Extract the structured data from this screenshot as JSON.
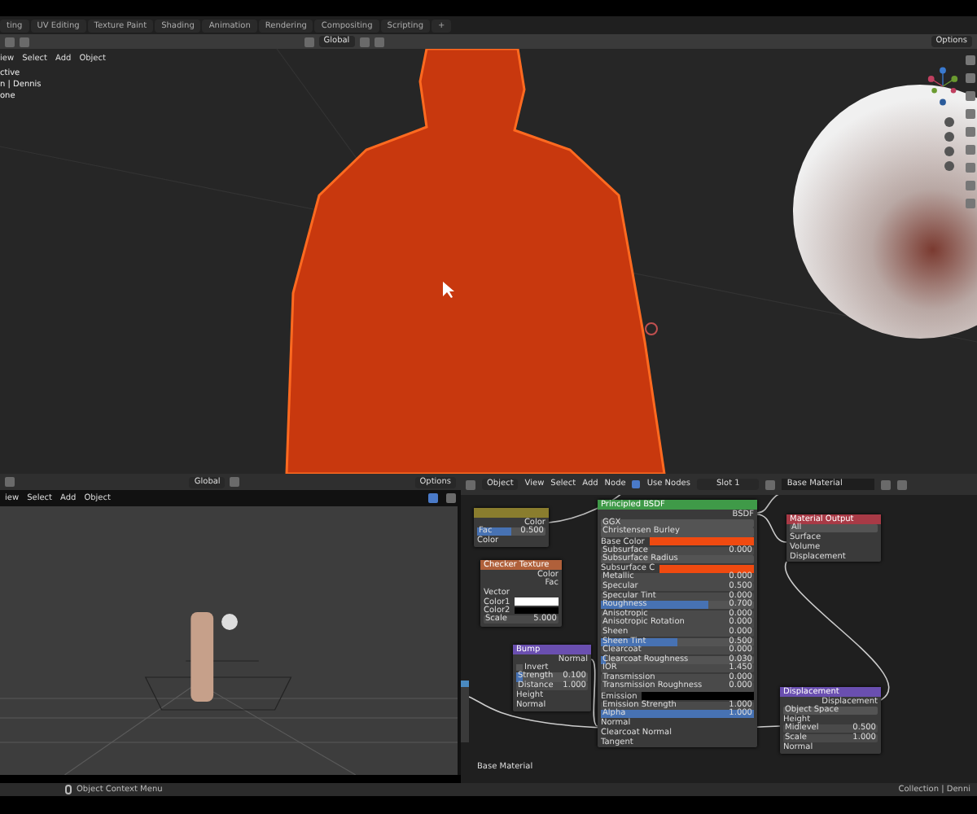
{
  "workspace_tabs": [
    {
      "label": "ting"
    },
    {
      "label": "UV Editing"
    },
    {
      "label": "Texture Paint"
    },
    {
      "label": "Shading"
    },
    {
      "label": "Animation"
    },
    {
      "label": "Rendering"
    },
    {
      "label": "Compositing"
    },
    {
      "label": "Scripting"
    },
    {
      "label": "+"
    }
  ],
  "top_viewport": {
    "menu": [
      "iew",
      "Select",
      "Add",
      "Object"
    ],
    "transform": "Global",
    "options": "Options",
    "overlay_lines": [
      "ctive",
      "n | Dennis",
      "one"
    ]
  },
  "bottom_viewport": {
    "menu": [
      "iew",
      "Select",
      "Add",
      "Object"
    ],
    "transform": "Global",
    "options": "Options"
  },
  "node_editor": {
    "object_mode": "Object",
    "menu": [
      "View",
      "Select",
      "Add",
      "Node"
    ],
    "use_nodes": {
      "label": "Use Nodes",
      "checked": true
    },
    "slot": "Slot 1",
    "material": "Base Material",
    "frame_label": "Base Material",
    "nodes": [
      {
        "color": "#8a7d2e",
        "rows": [
          {
            "kind": "output",
            "label": "Color"
          },
          {
            "kind": "bar",
            "label": "Fac",
            "value": "0.500",
            "level": 0.5
          },
          {
            "kind": "input",
            "label": "Color"
          }
        ]
      },
      {
        "title": "Checker Texture",
        "color": "#b0603a",
        "rows": [
          {
            "kind": "output",
            "label": "Color"
          },
          {
            "kind": "output",
            "label": "Fac"
          },
          {
            "kind": "input",
            "label": "Vector"
          },
          {
            "kind": "color",
            "label": "Color1",
            "color": "#ffffff"
          },
          {
            "kind": "color",
            "label": "Color2",
            "color": "#000000"
          },
          {
            "kind": "value",
            "label": "Scale",
            "value": "5.000"
          }
        ]
      },
      {
        "title": "Principled BSDF",
        "color": "#3f9a48",
        "rows": [
          {
            "kind": "output",
            "label": "BSDF"
          },
          {
            "kind": "dropdown",
            "label": "GGX"
          },
          {
            "kind": "dropdown",
            "label": "Christensen Burley"
          },
          {
            "kind": "color",
            "label": "Base Color",
            "color": "#f04a10"
          },
          {
            "kind": "value",
            "label": "Subsurface",
            "value": "0.000"
          },
          {
            "kind": "dropdown",
            "label": "Subsurface Radius"
          },
          {
            "kind": "color",
            "label": "Subsurface C",
            "color": "#f04a10"
          },
          {
            "kind": "value",
            "label": "Metallic",
            "value": "0.000"
          },
          {
            "kind": "value",
            "label": "Specular",
            "value": "0.500"
          },
          {
            "kind": "value",
            "label": "Specular Tint",
            "value": "0.000"
          },
          {
            "kind": "bar",
            "label": "Roughness",
            "value": "0.700",
            "level": 0.7
          },
          {
            "kind": "value",
            "label": "Anisotropic",
            "value": "0.000"
          },
          {
            "kind": "value",
            "label": "Anisotropic Rotation",
            "value": "0.000"
          },
          {
            "kind": "value",
            "label": "Sheen",
            "value": "0.000"
          },
          {
            "kind": "bar",
            "label": "Sheen Tint",
            "value": "0.500",
            "level": 0.5
          },
          {
            "kind": "value",
            "label": "Clearcoat",
            "value": "0.000"
          },
          {
            "kind": "bar",
            "label": "Clearcoat Roughness",
            "value": "0.030",
            "level": 0.03
          },
          {
            "kind": "value",
            "label": "IOR",
            "value": "1.450"
          },
          {
            "kind": "value",
            "label": "Transmission",
            "value": "0.000"
          },
          {
            "kind": "value",
            "label": "Transmission Roughness",
            "value": "0.000"
          },
          {
            "kind": "color",
            "label": "Emission",
            "color": "#000000"
          },
          {
            "kind": "value",
            "label": "Emission Strength",
            "value": "1.000"
          },
          {
            "kind": "bar",
            "label": "Alpha",
            "value": "1.000",
            "level": 1
          },
          {
            "kind": "input",
            "label": "Normal"
          },
          {
            "kind": "input",
            "label": "Clearcoat Normal"
          },
          {
            "kind": "input",
            "label": "Tangent"
          }
        ]
      },
      {
        "title": "Material Output",
        "color": "#a83a46",
        "rows": [
          {
            "kind": "dropdown",
            "label": "All"
          },
          {
            "kind": "input",
            "label": "Surface"
          },
          {
            "kind": "input",
            "label": "Volume"
          },
          {
            "kind": "input",
            "label": "Displacement"
          }
        ]
      },
      {
        "title": "Bump",
        "color": "#6a4fb0",
        "rows": [
          {
            "kind": "output",
            "label": "Normal"
          },
          {
            "kind": "check",
            "label": "Invert",
            "checked": false
          },
          {
            "kind": "bar",
            "label": "Strength",
            "value": "0.100",
            "level": 0.1
          },
          {
            "kind": "value",
            "label": "Distance",
            "value": "1.000"
          },
          {
            "kind": "input",
            "label": "Height"
          },
          {
            "kind": "input",
            "label": "Normal"
          }
        ]
      },
      {
        "title": "Displacement",
        "color": "#6a4fb0",
        "rows": [
          {
            "kind": "output",
            "label": "Displacement"
          },
          {
            "kind": "dropdown",
            "label": "Object Space"
          },
          {
            "kind": "input",
            "label": "Height"
          },
          {
            "kind": "value",
            "label": "Midlevel",
            "value": "0.500"
          },
          {
            "kind": "value",
            "label": "Scale",
            "value": "1.000"
          },
          {
            "kind": "input",
            "label": "Normal"
          }
        ]
      }
    ]
  },
  "status_bar": {
    "hint": "Object Context Menu",
    "info": "Collection | Denni"
  }
}
